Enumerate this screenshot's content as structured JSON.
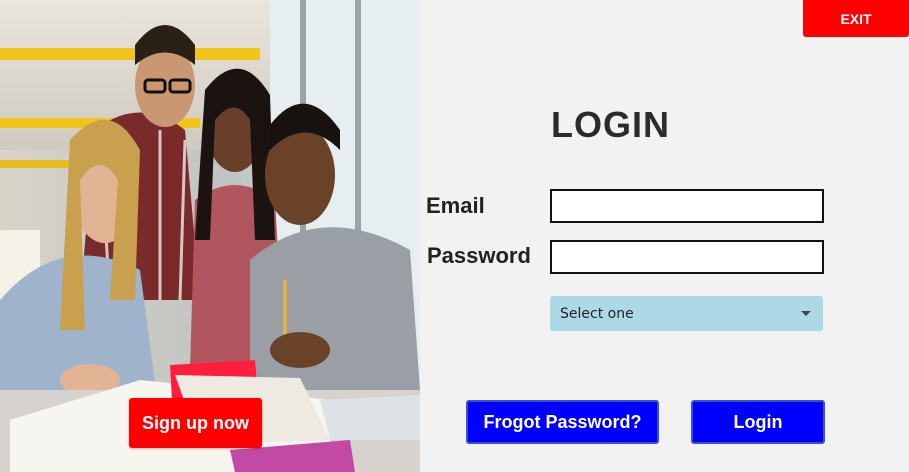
{
  "header": {
    "exit_label": "EXIT"
  },
  "hero": {
    "image": "students-studying-photo",
    "signup_label": "Sign up now"
  },
  "form": {
    "title": "LOGIN",
    "email_label": "Email",
    "email_value": "",
    "password_label": "Password",
    "password_value": "",
    "role_select": {
      "selected": "Select one",
      "icon": "chevron-down-icon"
    },
    "forgot_label": "Frogot Password?",
    "login_label": "Login"
  },
  "colors": {
    "danger": "#ff0000",
    "primary": "#0000ff",
    "select_bg": "#add8e6",
    "panel_bg": "#f2f2f2"
  }
}
